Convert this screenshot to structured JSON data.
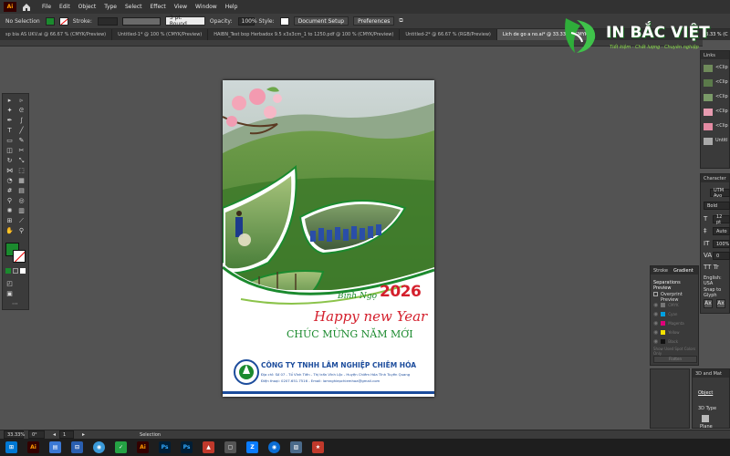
{
  "menubar": {
    "app_icon": "Ai",
    "items": [
      "File",
      "Edit",
      "Object",
      "Type",
      "Select",
      "Effect",
      "View",
      "Window",
      "Help"
    ]
  },
  "control_bar": {
    "selection": "No Selection",
    "stroke_label": "Stroke:",
    "brush": "3 pt. Round",
    "opacity_label": "Opacity:",
    "opacity_value": "100%",
    "style_label": "Style:",
    "doc_setup": "Document Setup",
    "preferences": "Preferences"
  },
  "tabs": [
    "sp bia AS UKV.ai @ 66.67 % (CMYK/Preview)",
    "Untitled-1* @ 100 % (CMYK/Preview)",
    "HAIBN_Test bop Herbadox 9.5 x3x3cm_1 to 1250.pdf @ 100 % (CMYK/Preview)",
    "Untitled-2* @ 66.67 % (RGB/Preview)",
    "Lich de go a no.ai* @ 33.33 % (CMYK"
  ],
  "zoom_right": "33.33 % (C",
  "links_panel": {
    "title": "Links",
    "items": [
      "<Clip",
      "<Clip",
      "<Clip",
      "<Clip",
      "<Clip",
      "Untitl"
    ]
  },
  "character_panel": {
    "title": "Character",
    "font": "UTM Avo",
    "style": "Bold",
    "size": "12 pt",
    "leading": "Auto",
    "scale": "100%",
    "tracking": "0",
    "lang": "English: USA",
    "snap": "Snap to Glyph"
  },
  "separations_panel": {
    "tabs": [
      "Stroke",
      "Gradient"
    ],
    "title": "Separations Preview",
    "overprint": "Overprint Preview",
    "inks": [
      {
        "name": "CMYK",
        "color": "#777777"
      },
      {
        "name": "Cyan",
        "color": "#00a0e0"
      },
      {
        "name": "Magenta",
        "color": "#e0007a"
      },
      {
        "name": "Yellow",
        "color": "#f5e100"
      },
      {
        "name": "Black",
        "color": "#111111"
      }
    ],
    "spot_only": "Show Used Spot Colors Only",
    "flatten": "Flatten"
  },
  "props_panel": {
    "title": "3D and Mat",
    "object": "Object",
    "type_label": "3D Type",
    "plane": "Plane"
  },
  "status_bar": {
    "zoom": "33.33%",
    "angle": "0°",
    "page": "1",
    "mode": "Selection"
  },
  "artwork": {
    "year": "2026",
    "binh_ngo": "Bính Ngọ",
    "happy": "Happy new Year",
    "chuc_mung": "CHÚC MỪNG NĂM MỚI",
    "company": "CÔNG TY TNHH LÂM NGHIỆP CHIÊM HÓA",
    "address": "Địa chỉ: Số 07 - Tổ Vĩnh Tiến - Thị trấn Vĩnh Lộc - Huyện Chiêm Hóa Tỉnh Tuyên Quang",
    "phone": "Điện thoại: 0207.651.7516 - Email: lamnghiepchiemhoa@gmail.com"
  },
  "watermark": {
    "brand": "IN BẮC VIỆT",
    "tagline": "Tiết kiệm · Chất lượng · Chuyên nghiệp"
  },
  "colors": {
    "accent_green": "#1b8a2e",
    "red": "#d41f2c",
    "blue": "#1c4c9c"
  }
}
